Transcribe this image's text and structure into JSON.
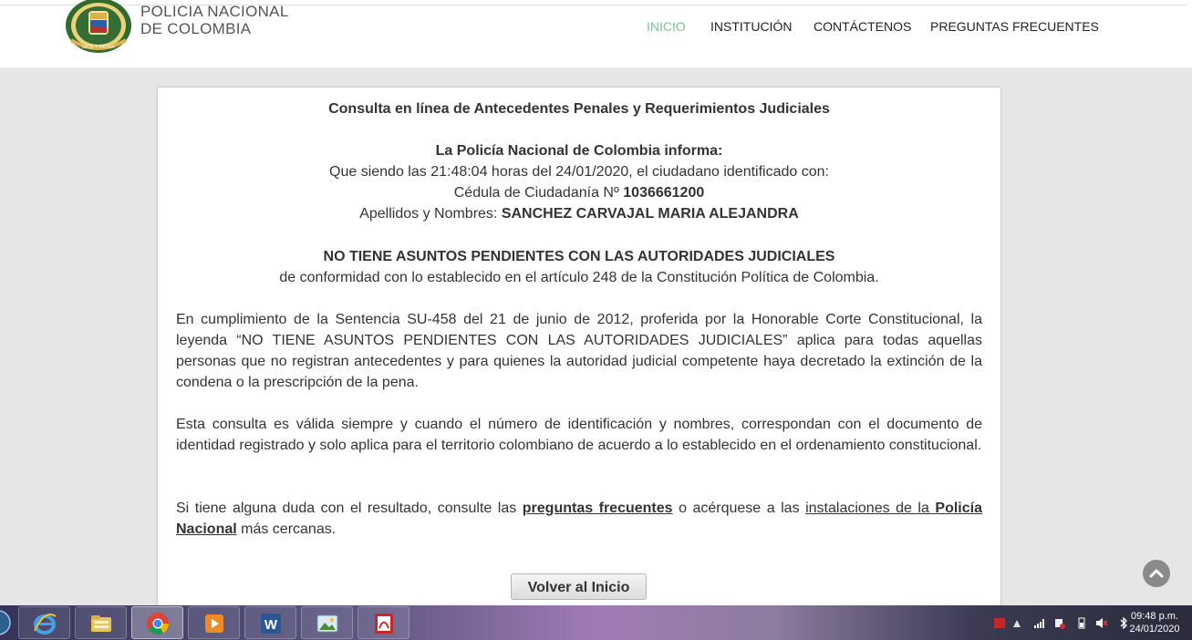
{
  "brand": {
    "line1": "POLICIA NACIONAL",
    "line2": "DE COLOMBIA",
    "logo_text": "DIOS Y PATRIA"
  },
  "nav": {
    "items": [
      {
        "label": "INICIO",
        "active": true
      },
      {
        "label": "INSTITUCIÓN",
        "active": false
      },
      {
        "label": "CONTÁCTENOS",
        "active": false
      },
      {
        "label": "PREGUNTAS FRECUENTES",
        "active": false
      }
    ]
  },
  "card": {
    "title": "Consulta en línea de Antecedentes Penales y Requerimientos Judiciales",
    "informa": "La Policía Nacional de Colombia informa:",
    "siendo_prefix": "Que siendo las 21:48:04 horas del 24/01/2020, el ciudadano identificado con:",
    "cedula_label": "Cédula de Ciudadanía Nº ",
    "cedula_value": "1036661200",
    "nombres_label": "Apellidos y Nombres: ",
    "nombres_value": "SANCHEZ CARVAJAL MARIA ALEJANDRA",
    "result": "NO TIENE ASUNTOS PENDIENTES CON LAS AUTORIDADES JUDICIALES",
    "conformidad": "de conformidad con lo establecido en el artículo 248 de la Constitución Política de Colombia.",
    "para1": "En cumplimiento de la Sentencia SU-458 del 21 de junio de 2012, proferida por la Honorable Corte Constitucional, la leyenda “NO TIENE ASUNTOS PENDIENTES CON LAS AUTORIDADES JUDICIALES” aplica para todas aquellas personas que no registran antecedentes y para quienes la autoridad judicial competente haya decretado la extinción de la condena o la prescripción de la pena.",
    "para2": "Esta consulta es válida siempre y cuando el número de identificación y nombres, correspondan con el documento de identidad registrado y solo aplica para el territorio colombiano de acuerdo a lo establecido en el ordenamiento constitucional.",
    "para3": {
      "text1": "Si tiene alguna duda con el resultado, consulte las ",
      "link1": "preguntas frecuentes",
      "text2": " o acérquese a las ",
      "link2a": "instalaciones de la ",
      "link2b": "Policía Nacional",
      "text3": " más cercanas."
    },
    "back_button": "Volver al Inicio"
  },
  "scroll_top_icon": "chevron-up-icon",
  "taskbar": {
    "apps": [
      "start-orb-icon",
      "internet-explorer-icon",
      "file-explorer-icon",
      "chrome-icon",
      "media-player-icon",
      "word-icon",
      "photo-viewer-icon",
      "pdf-reader-icon"
    ],
    "active_app": "chrome-icon",
    "clock_time": "09:48 p.m.",
    "clock_date": "24/01/2020"
  },
  "colors": {
    "nav_active": "#7cc3a0",
    "page_bg": "#e6e6e6",
    "text": "#333333"
  }
}
